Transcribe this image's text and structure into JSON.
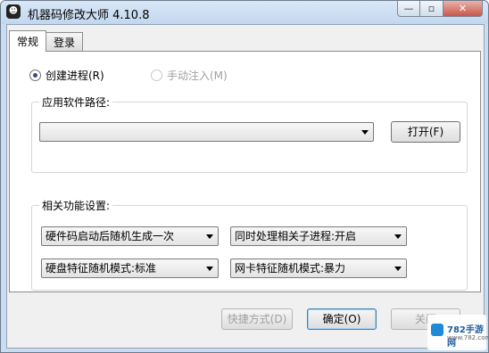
{
  "window": {
    "title": "机器码修改大师 4.10.8",
    "app_icon_glyph": "☻",
    "minimize_glyph": "—",
    "maximize_glyph": "▫",
    "close_glyph": "✕"
  },
  "tabs": [
    {
      "label": "常规",
      "active": true
    },
    {
      "label": "登录",
      "active": false
    }
  ],
  "mode": {
    "create_process": "创建进程(R)",
    "manual_inject": "手动注入(M)",
    "selected": "create_process"
  },
  "software_path": {
    "group_label": "应用软件路径:",
    "combo_value": "",
    "open_button": "打开(F)"
  },
  "settings": {
    "group_label": "相关功能设置:",
    "hardware_code_option": "硬件码启动后随机生成一次",
    "child_process_option": "同时处理相关子进程:开启",
    "disk_mode_option": "硬盘特征随机模式:标准",
    "nic_mode_option": "网卡特征随机模式:暴力"
  },
  "footer": {
    "shortcut_button": "快捷方式(D)",
    "ok_button": "确定(O)",
    "close_button": "关闭"
  },
  "watermark": {
    "number": "782手游网",
    "url": "www.782.com"
  }
}
